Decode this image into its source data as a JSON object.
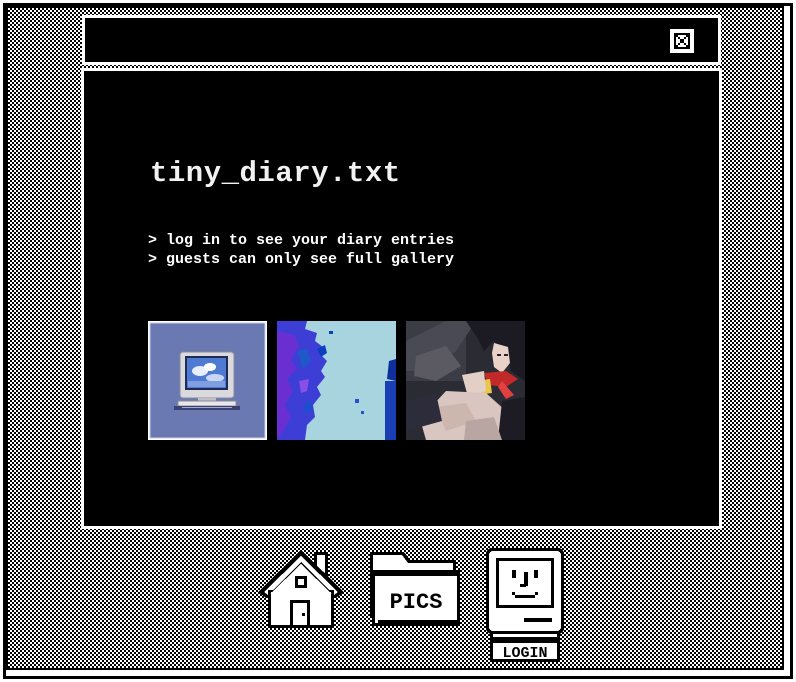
{
  "window": {
    "close_icon": "close-x-icon"
  },
  "main": {
    "title": "tiny_diary.txt",
    "notes": [
      "> log in to see your diary entries",
      "> guests can only see full gallery"
    ],
    "gallery": [
      {
        "icon": "retro-computer-image"
      },
      {
        "icon": "blue-abstract-image"
      },
      {
        "icon": "anime-girl-image"
      }
    ]
  },
  "dock": {
    "home": {
      "icon": "house-icon"
    },
    "pics": {
      "icon": "folder-icon",
      "label": "PICS"
    },
    "login": {
      "icon": "happy-mac-icon",
      "label": "LOGIN"
    }
  },
  "colors": {
    "background": "#000000",
    "text": "#ffffff",
    "frame": "#ffffff"
  }
}
